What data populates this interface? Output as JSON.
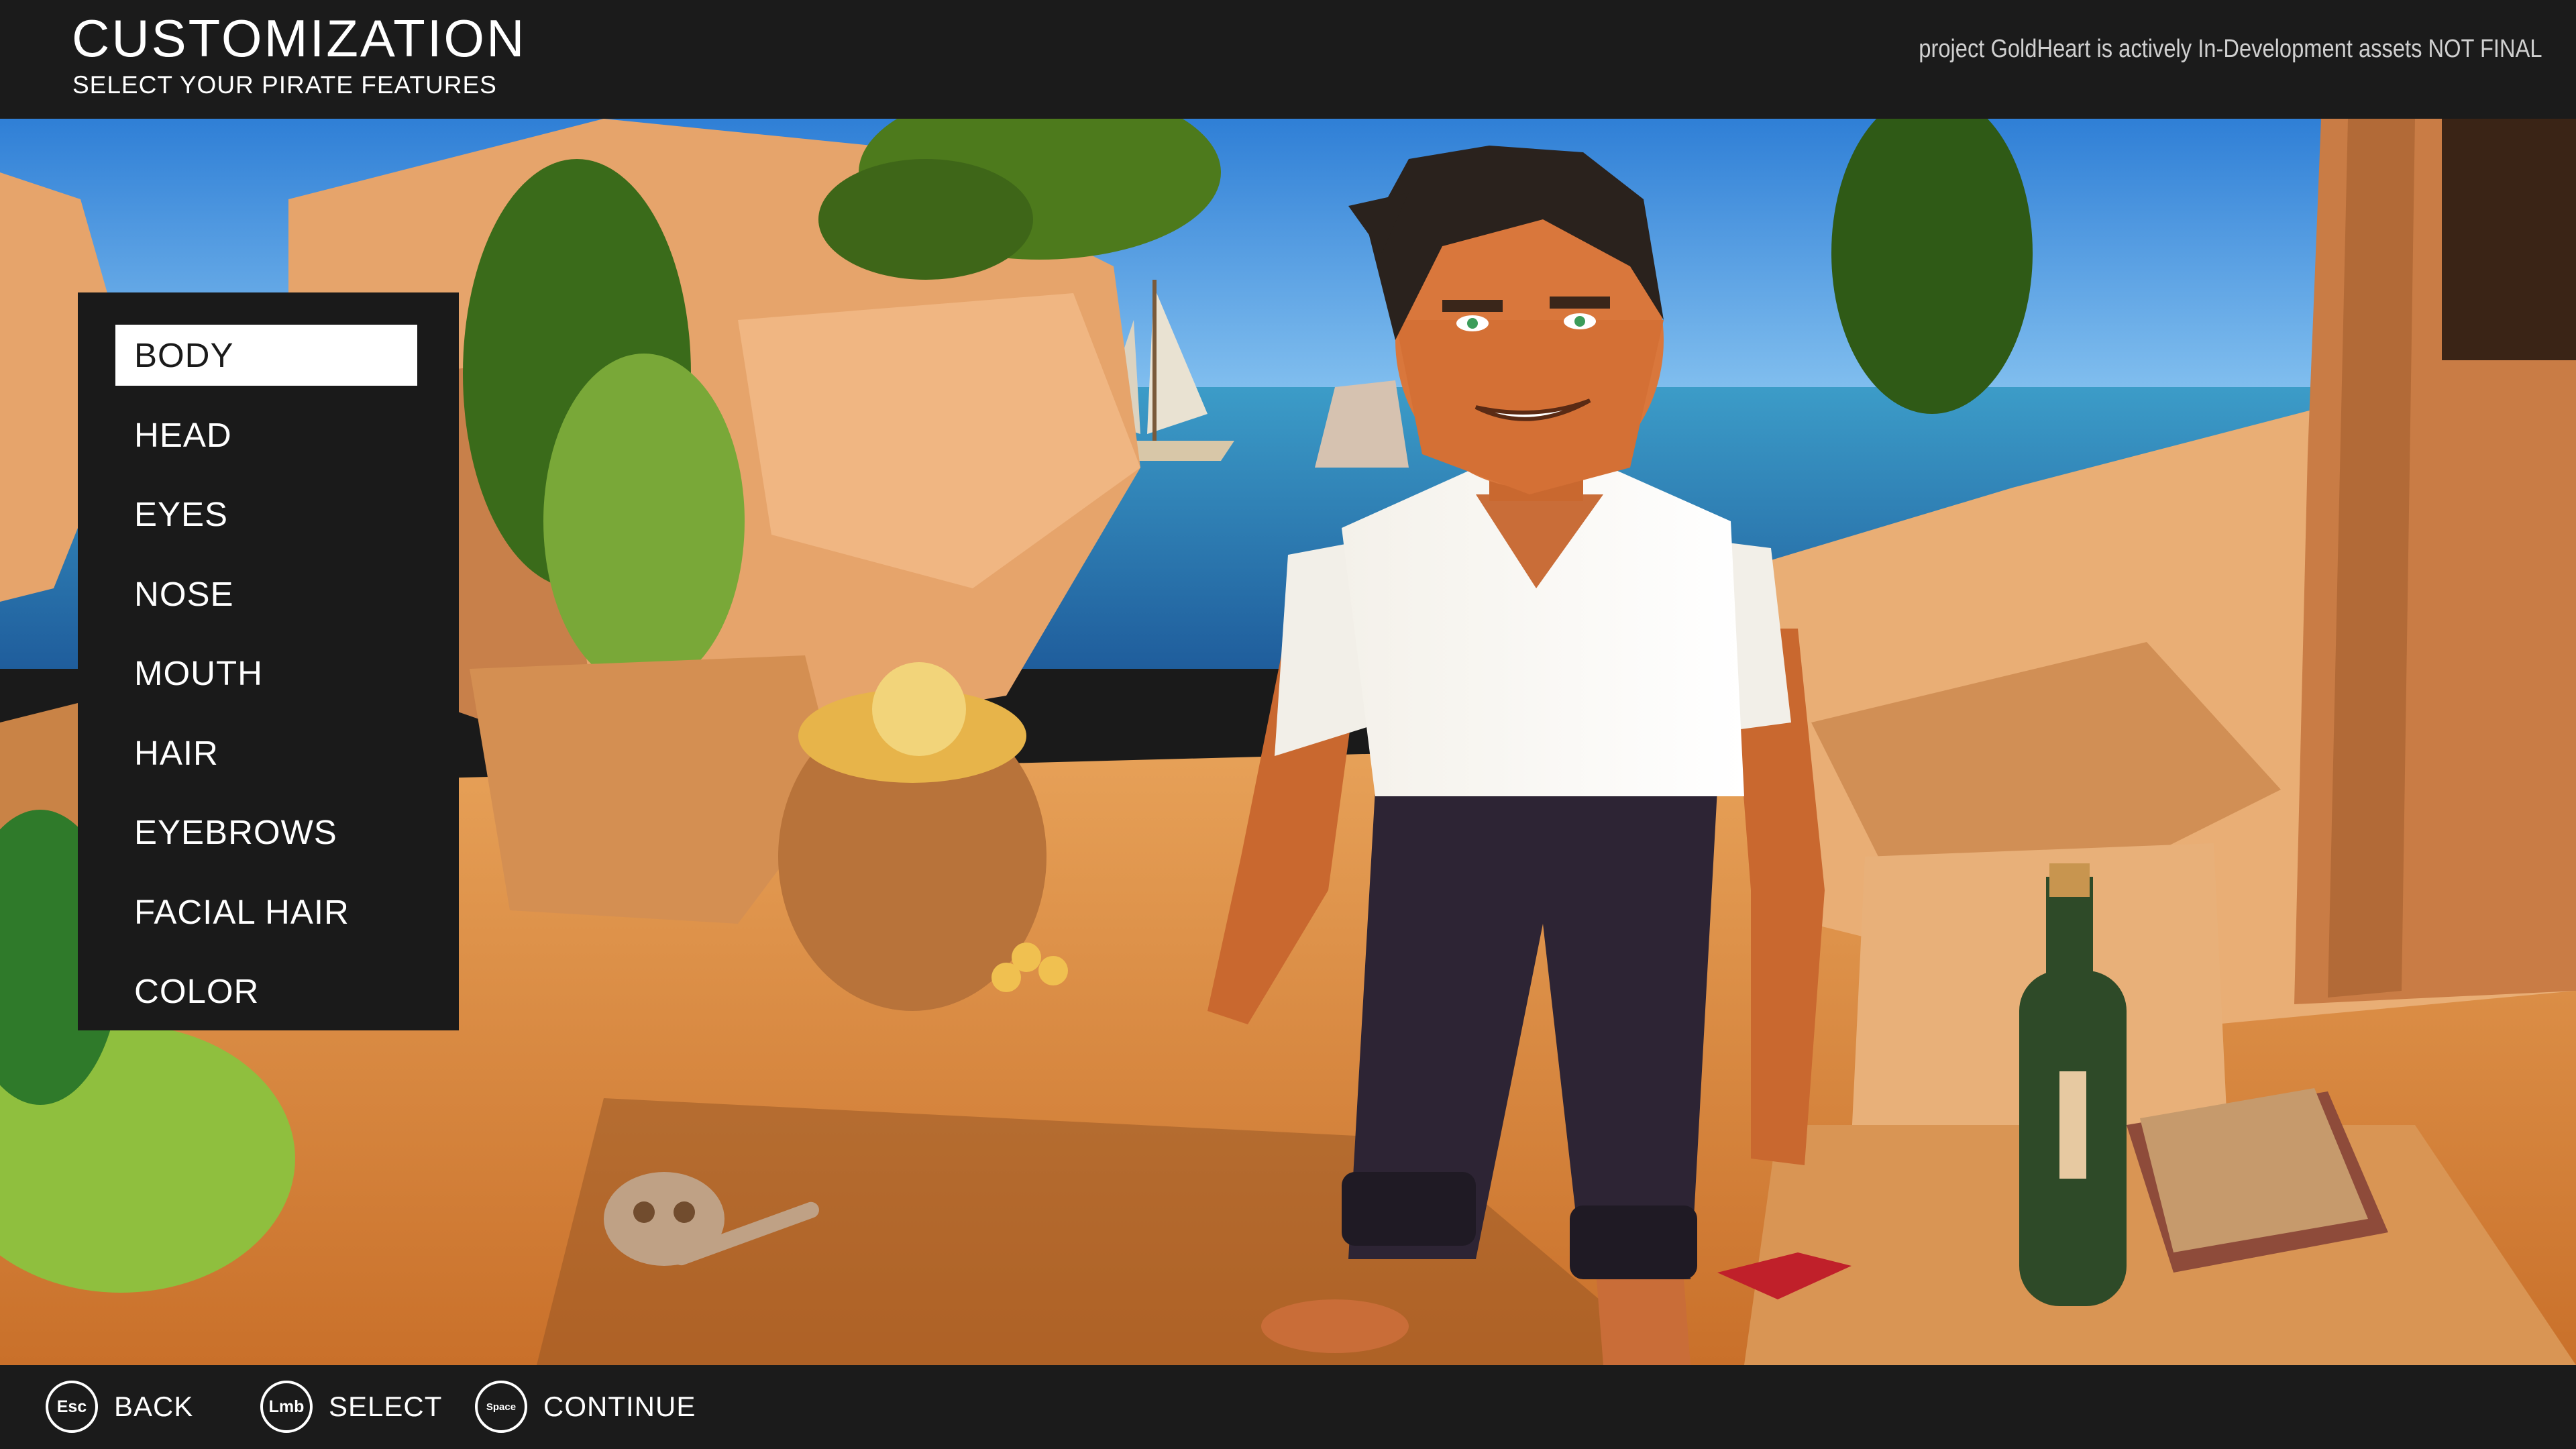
{
  "header": {
    "title": "CUSTOMIZATION",
    "subtitle": "SELECT YOUR PIRATE FEATURES",
    "dev_notice": "project GoldHeart is actively In-Development assets NOT FINAL"
  },
  "menu": {
    "selected_index": 0,
    "items": [
      {
        "label": "BODY"
      },
      {
        "label": "HEAD"
      },
      {
        "label": "EYES"
      },
      {
        "label": "NOSE"
      },
      {
        "label": "MOUTH"
      },
      {
        "label": "HAIR"
      },
      {
        "label": "EYEBROWS"
      },
      {
        "label": "FACIAL HAIR"
      },
      {
        "label": "COLOR"
      }
    ]
  },
  "footer": {
    "hints": [
      {
        "key": "Esc",
        "label": "BACK"
      },
      {
        "key": "Lmb",
        "label": "SELECT"
      },
      {
        "key": "Space",
        "label": "CONTINUE"
      }
    ]
  },
  "colors": {
    "ui_background": "#1b1b1b",
    "ui_text": "#ffffff",
    "selected_background": "#ffffff",
    "selected_text": "#1a1a1a",
    "sky": "#3f8fe0",
    "sea": "#2b6fb0",
    "rock": "#e2a26a",
    "sand": "#e59a4e",
    "foliage": "#4d7a1c"
  }
}
